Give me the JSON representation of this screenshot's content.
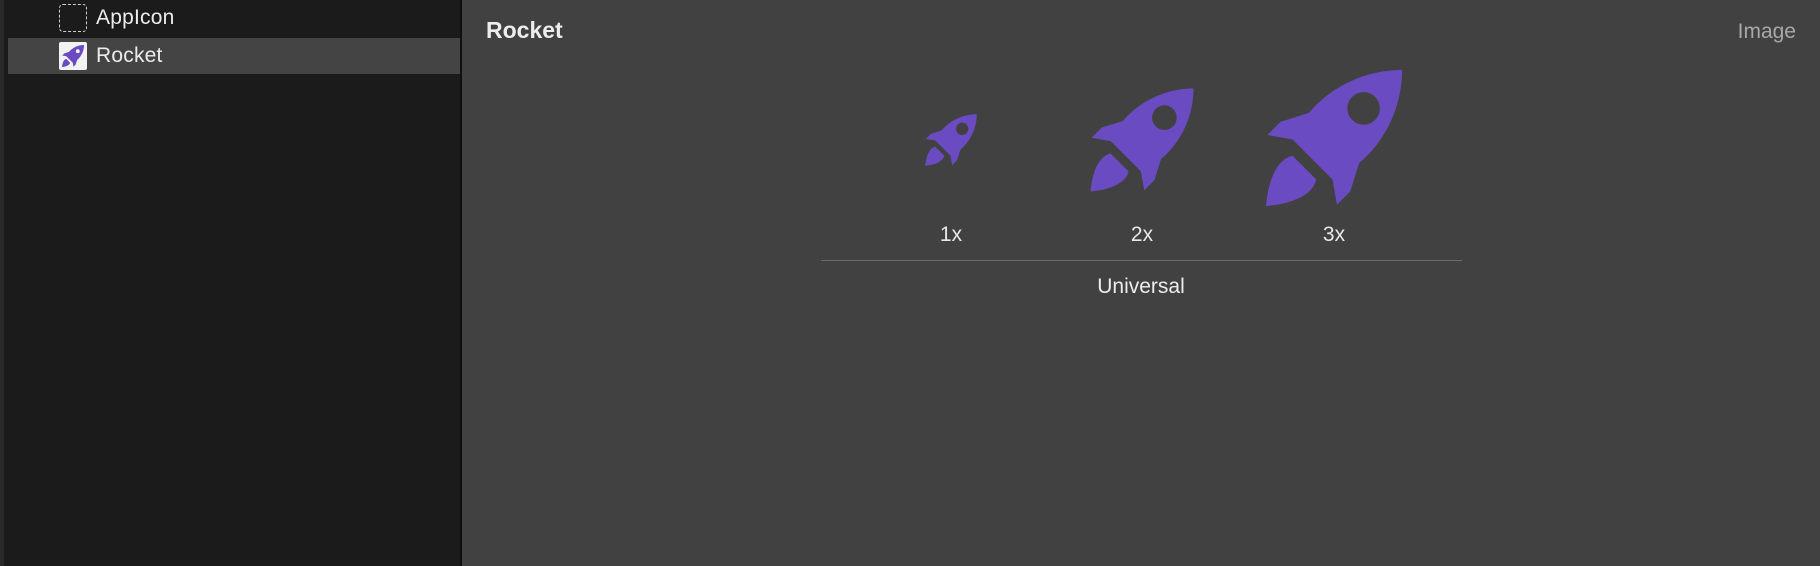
{
  "sidebar": {
    "items": [
      {
        "label": "AppIcon",
        "icon": "appicon-placeholder-icon",
        "selected": false
      },
      {
        "label": "Rocket",
        "icon": "rocket-icon",
        "selected": true
      }
    ]
  },
  "main": {
    "title": "Rocket",
    "kind_label": "Image",
    "slots": [
      {
        "scale": "1x"
      },
      {
        "scale": "2x"
      },
      {
        "scale": "3x"
      }
    ],
    "device_label": "Universal"
  },
  "colors": {
    "rocket": "#6b4bc2",
    "sidebar_bg": "#1b1b1b",
    "main_bg": "#414141",
    "selection": "#444444"
  }
}
